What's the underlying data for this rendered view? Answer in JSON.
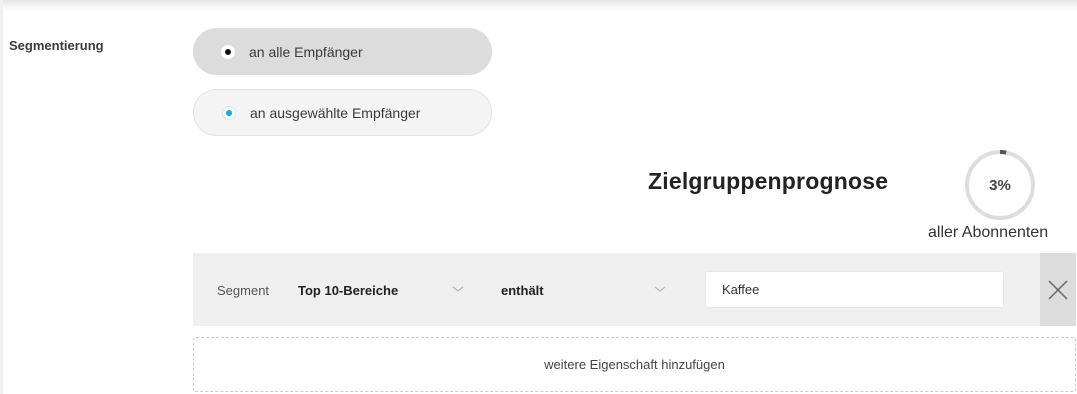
{
  "segmentation": {
    "label": "Segmentierung",
    "options": [
      {
        "label": "an alle Empfänger",
        "selected": false
      },
      {
        "label": "an ausgewählte Empfänger",
        "selected": true
      }
    ]
  },
  "forecast": {
    "title": "Zielgruppenprognose",
    "percent_label": "3%",
    "percent_value": 3,
    "caption": "aller Abonnenten"
  },
  "segment": {
    "label": "Segment",
    "field": "Top 10-Bereiche",
    "operator": "enthält",
    "value": "Kaffee"
  },
  "add_property_label": "weitere Eigenschaft hinzufügen",
  "colors": {
    "accent": "#1aa7da",
    "gauge_track": "#dddddd",
    "gauge_fill": "#555555"
  }
}
